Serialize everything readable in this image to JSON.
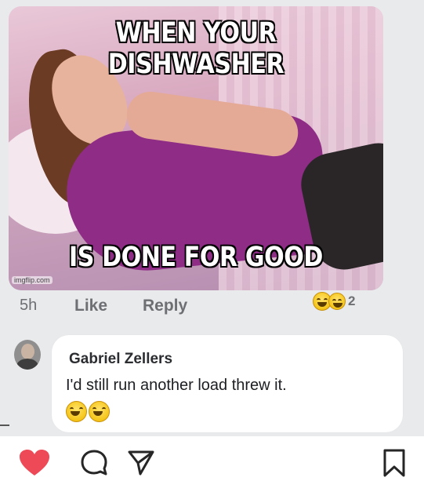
{
  "meme": {
    "top_text": "WHEN YOUR DISHWASHER",
    "bottom_text": "IS DONE FOR GOOD",
    "watermark": "imgflip.com"
  },
  "post_actions": {
    "time": "5h",
    "like_label": "Like",
    "reply_label": "Reply",
    "reaction_count": "2"
  },
  "comment": {
    "author": "Gabriel Zellers",
    "text": "I'd still run another load threw it.",
    "emojis": [
      "laughing-emoji",
      "laughing-emoji"
    ]
  },
  "bottom_bar": {
    "icons": [
      "heart-icon",
      "comment-icon",
      "share-icon",
      "bookmark-icon"
    ],
    "heart_color": "#ed4956"
  },
  "colors": {
    "background": "#e9eaec",
    "comment_bubble": "#ffffff",
    "muted_text": "#6d6f73"
  }
}
